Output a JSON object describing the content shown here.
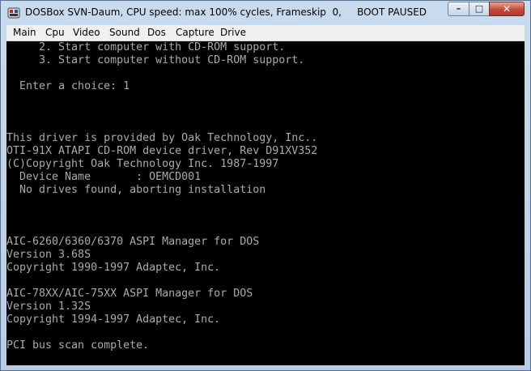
{
  "window": {
    "title": "DOSBox SVN-Daum, CPU speed: max 100% cycles, Frameskip  0,     BOOT PAUSED",
    "icon": "dosbox-app-icon",
    "controls": {
      "minimize": "–",
      "maximize": "□",
      "close": "✕"
    }
  },
  "menu": {
    "items": [
      "Main",
      "Cpu",
      "Video",
      "Sound",
      "Dos",
      "Capture",
      "Drive"
    ]
  },
  "console": {
    "lines": [
      "     2. Start computer with CD-ROM support.",
      "     3. Start computer without CD-ROM support.",
      "",
      "  Enter a choice: 1",
      "",
      "",
      "",
      "This driver is provided by Oak Technology, Inc..",
      "OTI-91X ATAPI CD-ROM device driver, Rev D91XV352",
      "(C)Copyright Oak Technology Inc. 1987-1997",
      "  Device Name       : OEMCD001",
      "  No drives found, aborting installation",
      "",
      "",
      "",
      "AIC-6260/6360/6370 ASPI Manager for DOS",
      "Version 3.68S",
      "Copyright 1990-1997 Adaptec, Inc.",
      "",
      "AIC-78XX/AIC-75XX ASPI Manager for DOS",
      "Version 1.32S",
      "Copyright 1994-1997 Adaptec, Inc.",
      "",
      "PCI bus scan complete."
    ]
  }
}
